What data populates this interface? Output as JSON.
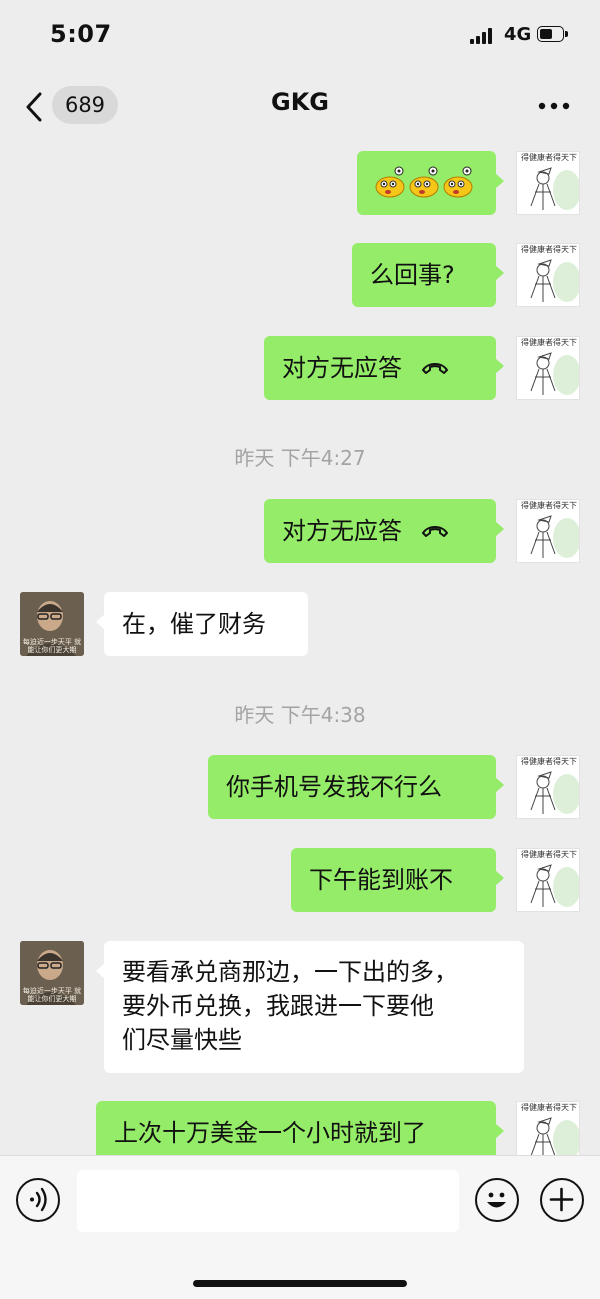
{
  "status_bar": {
    "time": "5:07",
    "network": "4G"
  },
  "nav": {
    "unread_count": "689",
    "title": "GKG"
  },
  "avatar_caption_me": "得健康者得天下",
  "avatar_caption_them": "每迫近一步天平\n就能让你们更大期",
  "messages": [
    {
      "side": "out",
      "type": "text",
      "text": "",
      "emoji": true
    },
    {
      "side": "out",
      "type": "text",
      "text": "么回事?"
    },
    {
      "side": "out",
      "type": "call",
      "text": "对方无应答"
    },
    {
      "type": "time",
      "text": "昨天 下午4:27"
    },
    {
      "side": "out",
      "type": "call",
      "text": "对方无应答"
    },
    {
      "side": "in",
      "type": "text",
      "text": "在，催了财务"
    },
    {
      "type": "time",
      "text": "昨天 下午4:38"
    },
    {
      "side": "out",
      "type": "text",
      "text": "你手机号发我不行么"
    },
    {
      "side": "out",
      "type": "text",
      "text": "下午能到账不"
    },
    {
      "side": "in",
      "type": "text",
      "lines": [
        "要看承兑商那边，一下出的多，",
        "要外币兑换，我跟进一下要他",
        "们尽量快些"
      ]
    },
    {
      "side": "out",
      "type": "text",
      "text": "上次十万美金一个小时就到了"
    }
  ],
  "input": {
    "placeholder": ""
  },
  "colors": {
    "outgoing_bubble": "#95ec69",
    "incoming_bubble": "#ffffff",
    "background": "#ededed"
  }
}
